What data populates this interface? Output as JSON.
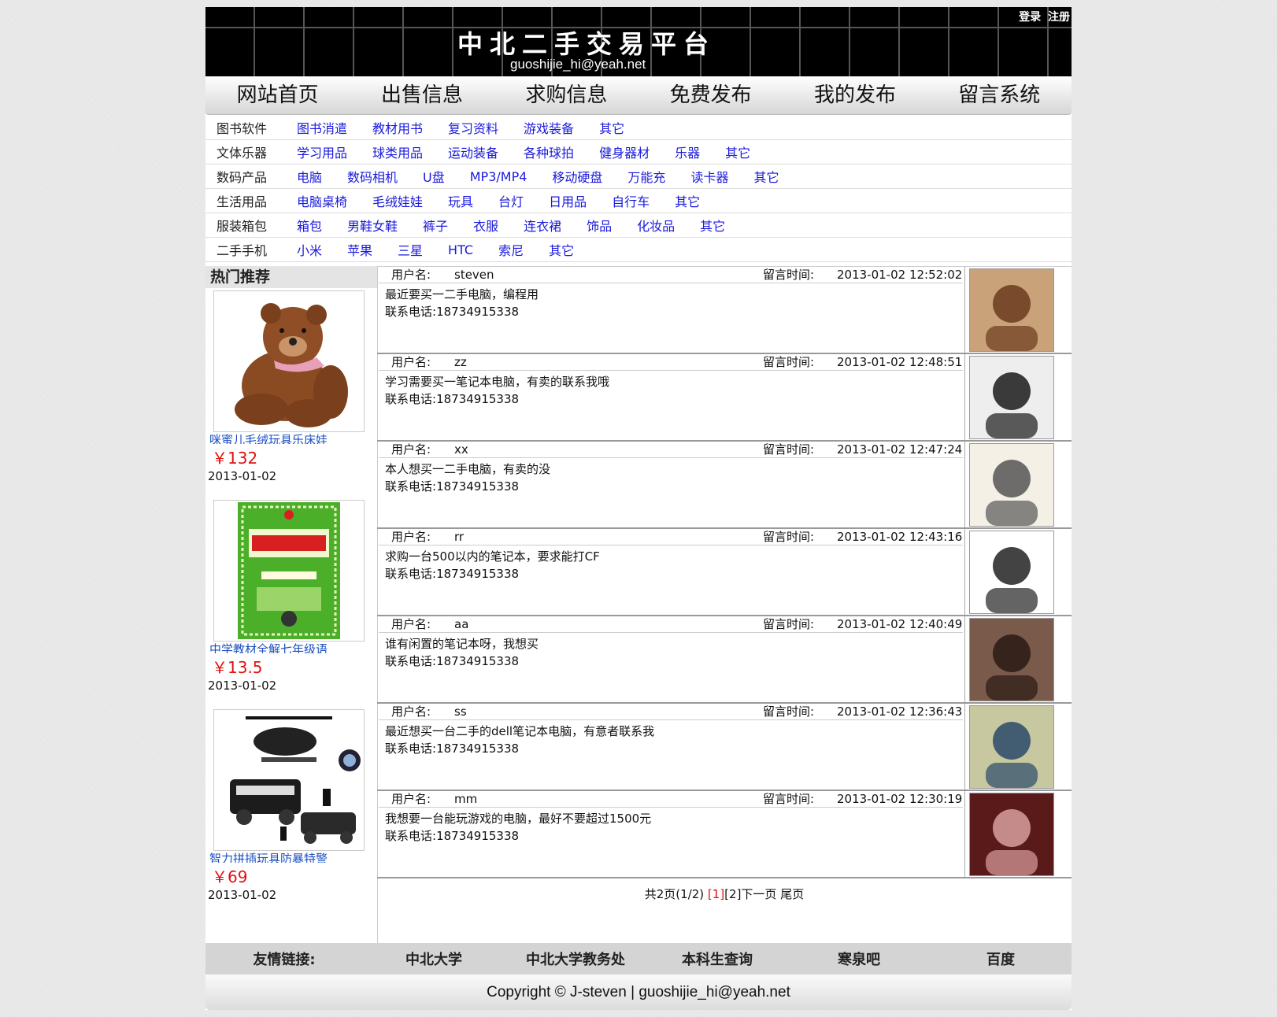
{
  "header": {
    "title": "中北二手交易平台",
    "email": "guoshijie_hi@yeah.net",
    "login": "登录",
    "register": "注册"
  },
  "nav": [
    "网站首页",
    "出售信息",
    "求购信息",
    "免费发布",
    "我的发布",
    "留言系统"
  ],
  "categories": [
    {
      "name": "图书软件",
      "links": [
        "图书消遣",
        "教材用书",
        "复习资料",
        "游戏装备",
        "其它"
      ]
    },
    {
      "name": "文体乐器",
      "links": [
        "学习用品",
        "球类用品",
        "运动装备",
        "各种球拍",
        "健身器材",
        "乐器",
        "其它"
      ]
    },
    {
      "name": "数码产品",
      "links": [
        "电脑",
        "数码相机",
        "U盘",
        "MP3/MP4",
        "移动硬盘",
        "万能充",
        "读卡器",
        "其它"
      ]
    },
    {
      "name": "生活用品",
      "links": [
        "电脑桌椅",
        "毛绒娃娃",
        "玩具",
        "台灯",
        "日用品",
        "自行车",
        "其它"
      ]
    },
    {
      "name": "服装箱包",
      "links": [
        "箱包",
        "男鞋女鞋",
        "裤子",
        "衣服",
        "连衣裙",
        "饰品",
        "化妆品",
        "其它"
      ]
    },
    {
      "name": "二手手机",
      "links": [
        "小米",
        "苹果",
        "三星",
        "HTC",
        "索尼",
        "其它"
      ]
    }
  ],
  "sidebar": {
    "title": "热门推荐",
    "products": [
      {
        "name": "咪蜜儿毛绒玩具乐床娃",
        "price": "￥132",
        "date": "2013-01-02"
      },
      {
        "name": "中学教材全解七年级语",
        "price": "￥13.5",
        "date": "2013-01-02"
      },
      {
        "name": "智力拼插玩具防暴特警",
        "price": "￥69",
        "date": "2013-01-02"
      }
    ]
  },
  "messages_labels": {
    "user": "用户名:",
    "time": "留言时间:",
    "phone_label": "联系电话:"
  },
  "messages": [
    {
      "user": "steven",
      "time": "2013-01-02 12:52:02",
      "text": "最近要买一二手电脑，编程用",
      "phone": "18734915338"
    },
    {
      "user": "zz",
      "time": "2013-01-02 12:48:51",
      "text": "学习需要买一笔记本电脑，有卖的联系我哦",
      "phone": "18734915338"
    },
    {
      "user": "xx",
      "time": "2013-01-02 12:47:24",
      "text": "本人想买一二手电脑，有卖的没",
      "phone": "18734915338"
    },
    {
      "user": "rr",
      "time": "2013-01-02 12:43:16",
      "text": "求购一台500以内的笔记本，要求能打CF",
      "phone": "18734915338"
    },
    {
      "user": "aa",
      "time": "2013-01-02 12:40:49",
      "text": "谁有闲置的笔记本呀，我想买",
      "phone": "18734915338"
    },
    {
      "user": "ss",
      "time": "2013-01-02 12:36:43",
      "text": "最近想买一台二手的dell笔记本电脑，有意者联系我",
      "phone": "18734915338"
    },
    {
      "user": "mm",
      "time": "2013-01-02 12:30:19",
      "text": "我想要一台能玩游戏的电脑，最好不要超过1500元",
      "phone": "18734915338"
    }
  ],
  "pager": {
    "summary": "共2页(1/2)",
    "current": "[1]",
    "page2": "[2]",
    "next": "下一页",
    "last": "尾页"
  },
  "friend_links": {
    "label": "友情链接:",
    "links": [
      "中北大学",
      "中北大学教务处",
      "本科生查询",
      "寒泉吧",
      "百度"
    ]
  },
  "footer": {
    "copyright": "Copyright © J-steven | guoshijie_hi@yeah.net"
  },
  "colors": {
    "link": "#1a1add",
    "price": "#e01010",
    "header_bg": "#000000"
  }
}
